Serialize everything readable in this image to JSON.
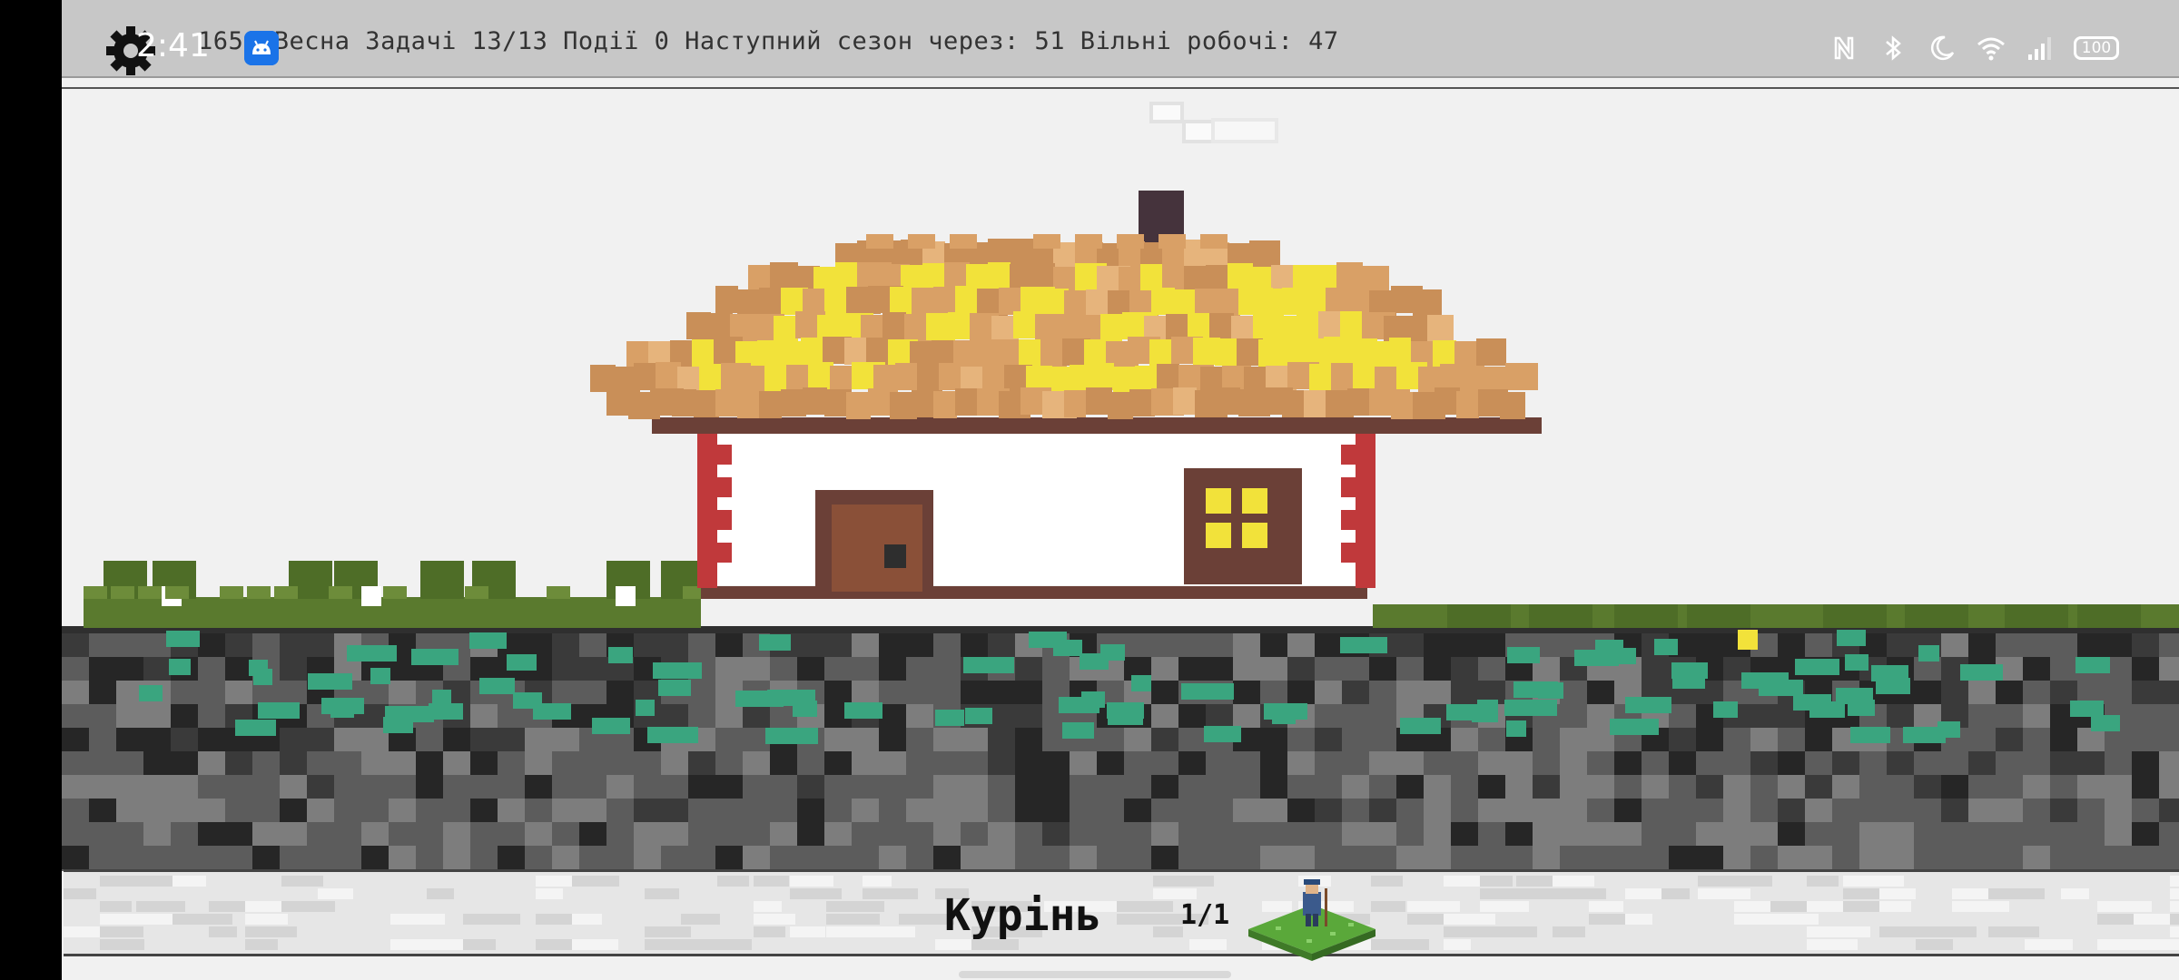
{
  "hud": {
    "status_text": "1656 Весна Задачі 13/13 Події 0 Наступний сезон через: 51 Вільні робочі: 47",
    "settings_icon": "gear-icon"
  },
  "system_bar": {
    "time": "2:41",
    "notification_icon": "android-icon",
    "icons": [
      "nfc-icon",
      "bluetooth-icon",
      "moon-icon",
      "wifi-icon",
      "signal-icon"
    ],
    "battery": "100"
  },
  "building_panel": {
    "name": "Курінь",
    "count": "1/1",
    "icon": "farmer-tile-icon"
  },
  "colors": {
    "roof_thatch": "#d9a066",
    "roof_yellow": "#f2e23a",
    "wall": "#ffffff",
    "trim": "#c0393b",
    "beam": "#6b4037",
    "grass": "#5a7a2e",
    "soil_dark": "#2e2e2e",
    "soil_gray": "#777777",
    "mineral": "#3aa57f"
  }
}
